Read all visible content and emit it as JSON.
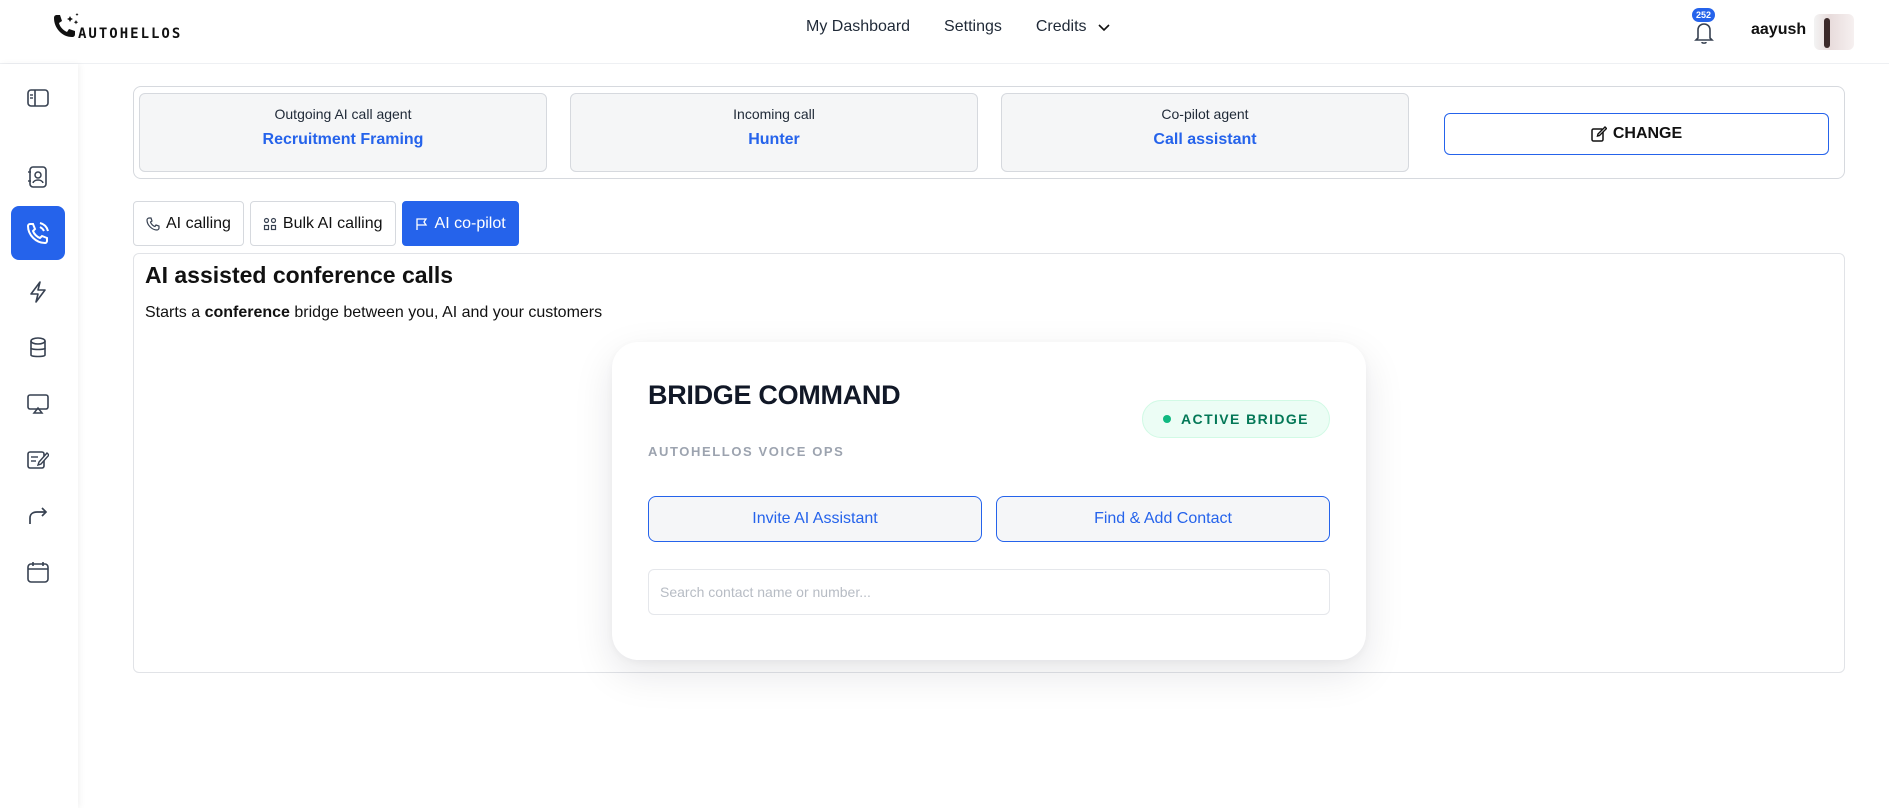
{
  "header": {
    "logo_text": "AUTOHELLOS",
    "nav": [
      {
        "label": "My Dashboard"
      },
      {
        "label": "Settings"
      },
      {
        "label": "Credits"
      }
    ],
    "notification_count": "252",
    "username": "aayush"
  },
  "sidebar": {
    "items": [
      {
        "icon": "sidebar-toggle-icon"
      },
      {
        "icon": "contacts-icon"
      },
      {
        "icon": "phone-call-icon",
        "active": true
      },
      {
        "icon": "lightning-icon"
      },
      {
        "icon": "database-icon"
      },
      {
        "icon": "screen-share-icon"
      },
      {
        "icon": "edit-notes-icon"
      },
      {
        "icon": "forward-icon"
      },
      {
        "icon": "calendar-icon"
      }
    ]
  },
  "agents": [
    {
      "label": "Outgoing AI call agent",
      "value": "Recruitment Framing"
    },
    {
      "label": "Incoming call",
      "value": "Hunter"
    },
    {
      "label": "Co-pilot agent",
      "value": "Call assistant"
    }
  ],
  "change_label": "CHANGE",
  "tabs": [
    {
      "label": "AI calling",
      "icon": "phone-icon",
      "active": false
    },
    {
      "label": "Bulk AI calling",
      "icon": "grid-icon",
      "active": false
    },
    {
      "label": "AI co-pilot",
      "icon": "flag-icon",
      "active": true
    }
  ],
  "panel": {
    "title": "AI assisted conference calls",
    "desc_before": "Starts a ",
    "desc_bold": "conference",
    "desc_after": " bridge between you, AI and your customers"
  },
  "bridge": {
    "title": "BRIDGE COMMAND",
    "subtitle": "AUTOHELLOS VOICE OPS",
    "status": "ACTIVE BRIDGE",
    "invite_label": "Invite AI Assistant",
    "add_contact_label": "Find & Add Contact",
    "search_placeholder": "Search contact name or number..."
  },
  "colors": {
    "accent": "#2563eb",
    "status_green": "#047857"
  }
}
